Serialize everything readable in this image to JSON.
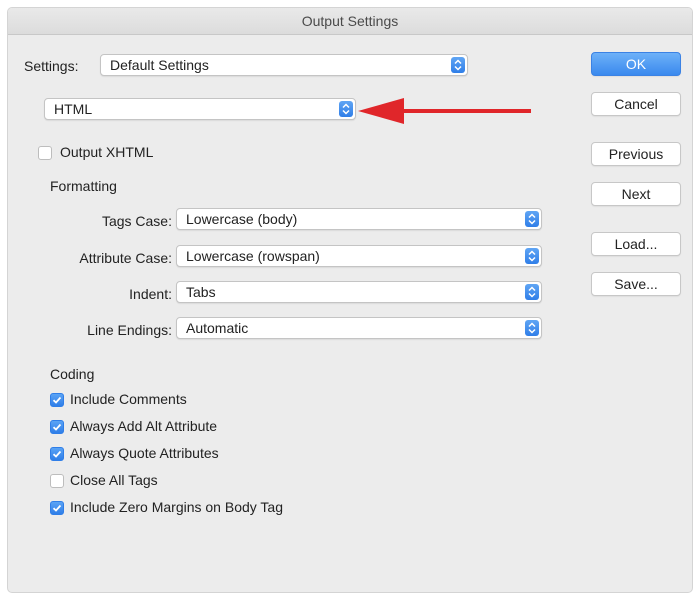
{
  "window": {
    "title": "Output Settings"
  },
  "settings": {
    "label": "Settings:",
    "value": "Default Settings"
  },
  "category": {
    "value": "HTML"
  },
  "output_xhtml": {
    "label": "Output XHTML",
    "checked": false
  },
  "formatting": {
    "heading": "Formatting",
    "tags_case": {
      "label": "Tags Case:",
      "value": "Lowercase (body)"
    },
    "attribute_case": {
      "label": "Attribute Case:",
      "value": "Lowercase (rowspan)"
    },
    "indent": {
      "label": "Indent:",
      "value": "Tabs"
    },
    "line_endings": {
      "label": "Line Endings:",
      "value": "Automatic"
    }
  },
  "coding": {
    "heading": "Coding",
    "options": [
      {
        "label": "Include Comments",
        "checked": true
      },
      {
        "label": "Always Add Alt Attribute",
        "checked": true
      },
      {
        "label": "Always Quote Attributes",
        "checked": true
      },
      {
        "label": "Close All Tags",
        "checked": false
      },
      {
        "label": "Include Zero Margins on Body Tag",
        "checked": true
      }
    ]
  },
  "buttons": {
    "ok": "OK",
    "cancel": "Cancel",
    "previous": "Previous",
    "next": "Next",
    "load": "Load...",
    "save": "Save..."
  },
  "colors": {
    "accent": "#3a89ee",
    "arrow": "#e0262a",
    "window_bg": "#ececec"
  }
}
